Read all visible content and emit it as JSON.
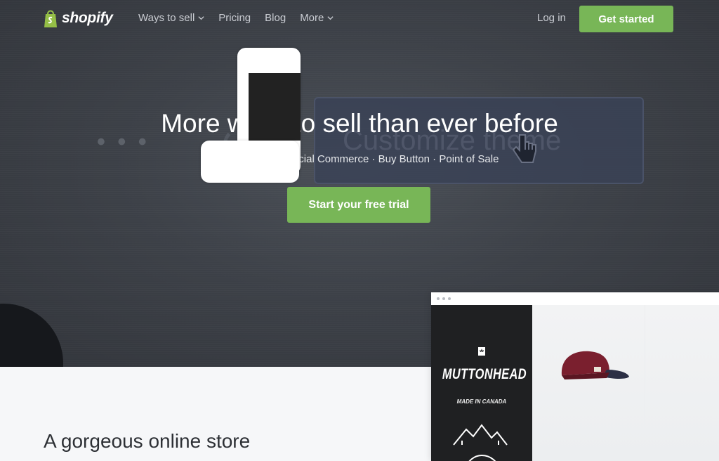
{
  "nav": {
    "logo_text": "shopify",
    "items": [
      {
        "label": "Ways to sell",
        "has_dropdown": true
      },
      {
        "label": "Pricing",
        "has_dropdown": false
      },
      {
        "label": "Blog",
        "has_dropdown": false
      },
      {
        "label": "More",
        "has_dropdown": true
      }
    ],
    "login_label": "Log in",
    "cta_label": "Get started"
  },
  "hero": {
    "background_button_text": "Customize theme",
    "headline": "More ways to sell than ever before",
    "subline": "Ecommerce · Social Commerce · Buy Button · Point of Sale",
    "cta_label": "Start your free trial"
  },
  "section": {
    "title": "A gorgeous online store"
  },
  "store_preview": {
    "brand": "MUTTONHEAD",
    "brand_sub": "MADE IN CANADA"
  },
  "colors": {
    "accent_green": "#78b657",
    "hero_bg": "#3d4148",
    "page_bg": "#f6f7f9",
    "cap": "#7a1f2e"
  },
  "icons": [
    "shopify-bag-icon",
    "chevron-down-icon",
    "canada-flag-icon",
    "mountains-icon",
    "cap-image"
  ]
}
